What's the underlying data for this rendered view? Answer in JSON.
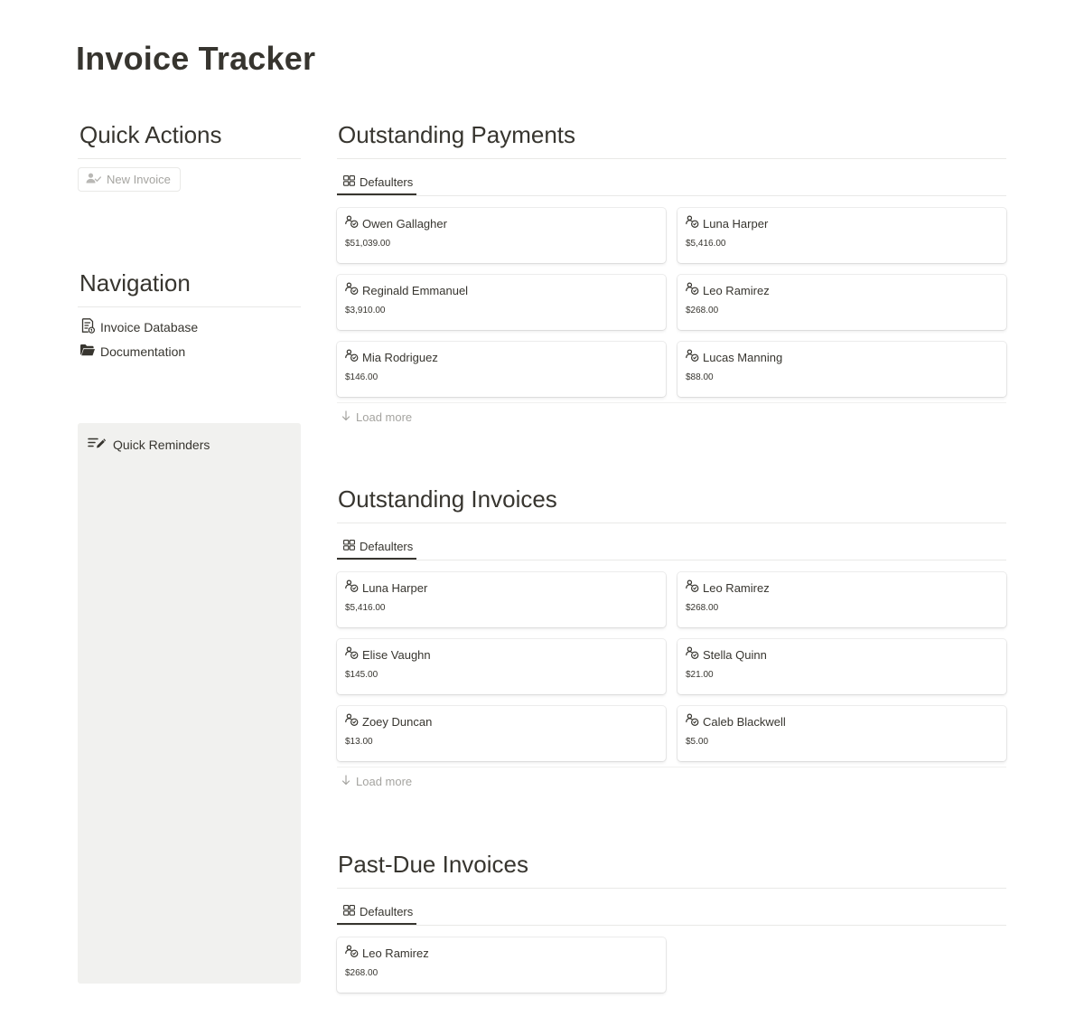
{
  "page": {
    "title": "Invoice Tracker"
  },
  "quick_actions": {
    "heading": "Quick Actions",
    "new_invoice_label": "New Invoice"
  },
  "navigation": {
    "heading": "Navigation",
    "items": [
      {
        "label": "Invoice Database",
        "icon": "invoice-icon"
      },
      {
        "label": "Documentation",
        "icon": "folder-open-icon"
      }
    ]
  },
  "reminders": {
    "label": "Quick Reminders",
    "icon": "list-pencil-icon"
  },
  "sections": [
    {
      "heading": "Outstanding Payments",
      "tab_label": "Defaulters",
      "load_more_label": "Load more",
      "cards": [
        {
          "name": "Owen Gallagher",
          "amount": "$51,039.00"
        },
        {
          "name": "Luna Harper",
          "amount": "$5,416.00"
        },
        {
          "name": "Reginald Emmanuel",
          "amount": "$3,910.00"
        },
        {
          "name": "Leo Ramirez",
          "amount": "$268.00"
        },
        {
          "name": "Mia Rodriguez",
          "amount": "$146.00"
        },
        {
          "name": "Lucas Manning",
          "amount": "$88.00"
        }
      ]
    },
    {
      "heading": "Outstanding Invoices",
      "tab_label": "Defaulters",
      "load_more_label": "Load more",
      "cards": [
        {
          "name": "Luna Harper",
          "amount": "$5,416.00"
        },
        {
          "name": "Leo Ramirez",
          "amount": "$268.00"
        },
        {
          "name": "Elise Vaughn",
          "amount": "$145.00"
        },
        {
          "name": "Stella Quinn",
          "amount": "$21.00"
        },
        {
          "name": "Zoey Duncan",
          "amount": "$13.00"
        },
        {
          "name": "Caleb Blackwell",
          "amount": "$5.00"
        }
      ]
    },
    {
      "heading": "Past-Due Invoices",
      "tab_label": "Defaulters",
      "cards": [
        {
          "name": "Leo Ramirez",
          "amount": "$268.00"
        }
      ]
    }
  ]
}
